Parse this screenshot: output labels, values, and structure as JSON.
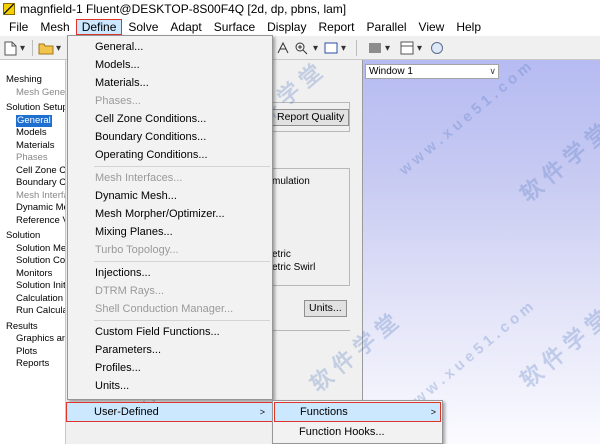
{
  "window": {
    "title": "magnfield-1 Fluent@DESKTOP-8S00F4Q  [2d, dp, pbns, lam]"
  },
  "menubar": {
    "items": [
      "File",
      "Mesh",
      "Define",
      "Solve",
      "Adapt",
      "Surface",
      "Display",
      "Report",
      "Parallel",
      "View",
      "Help"
    ],
    "active": "Define"
  },
  "colors": {
    "highlight": "#cce8ff",
    "highlight_border": "#e0342a",
    "tree_selection": "#1e6fd0"
  },
  "tree": {
    "groups": [
      {
        "label": "Meshing",
        "children": [
          {
            "label": "Mesh Generation",
            "state": "dim"
          }
        ]
      },
      {
        "label": "Solution Setup",
        "children": [
          {
            "label": "General",
            "state": "selected"
          },
          {
            "label": "Models",
            "state": "normal"
          },
          {
            "label": "Materials",
            "state": "normal"
          },
          {
            "label": "Phases",
            "state": "dim"
          },
          {
            "label": "Cell Zone Conditions",
            "state": "normal"
          },
          {
            "label": "Boundary Conditions",
            "state": "normal"
          },
          {
            "label": "Mesh Interfaces",
            "state": "dim"
          },
          {
            "label": "Dynamic Mesh",
            "state": "normal"
          },
          {
            "label": "Reference Values",
            "state": "normal"
          }
        ]
      },
      {
        "label": "Solution",
        "children": [
          {
            "label": "Solution Methods",
            "state": "normal"
          },
          {
            "label": "Solution Controls",
            "state": "normal"
          },
          {
            "label": "Monitors",
            "state": "normal"
          },
          {
            "label": "Solution Initialization",
            "state": "normal"
          },
          {
            "label": "Calculation Activities",
            "state": "normal"
          },
          {
            "label": "Run Calculation",
            "state": "normal"
          }
        ]
      },
      {
        "label": "Results",
        "children": [
          {
            "label": "Graphics and Animations",
            "state": "normal"
          },
          {
            "label": "Plots",
            "state": "normal"
          },
          {
            "label": "Reports",
            "state": "normal"
          }
        ]
      }
    ]
  },
  "general_panel": {
    "report_quality_label": "Report Quality",
    "simulation_label": "mulation",
    "option_axisymmetric": "etric",
    "option_axisymmetric_swirl": "etric Swirl",
    "units_label": "Units..."
  },
  "graphics": {
    "window_selector": "Window 1"
  },
  "define_menu": {
    "items": [
      {
        "label": "General...",
        "enabled": true
      },
      {
        "label": "Models...",
        "enabled": true
      },
      {
        "label": "Materials...",
        "enabled": true
      },
      {
        "label": "Phases...",
        "enabled": false
      },
      {
        "label": "Cell Zone Conditions...",
        "enabled": true
      },
      {
        "label": "Boundary Conditions...",
        "enabled": true
      },
      {
        "label": "Operating Conditions...",
        "enabled": true
      },
      {
        "separator": true
      },
      {
        "label": "Mesh Interfaces...",
        "enabled": false
      },
      {
        "label": "Dynamic Mesh...",
        "enabled": true
      },
      {
        "label": "Mesh Morpher/Optimizer...",
        "enabled": true
      },
      {
        "label": "Mixing Planes...",
        "enabled": true
      },
      {
        "label": "Turbo Topology...",
        "enabled": false
      },
      {
        "separator": true
      },
      {
        "label": "Injections...",
        "enabled": true
      },
      {
        "label": "DTRM Rays...",
        "enabled": false
      },
      {
        "label": "Shell Conduction Manager...",
        "enabled": false
      },
      {
        "separator": true
      },
      {
        "label": "Custom Field Functions...",
        "enabled": true
      },
      {
        "label": "Parameters...",
        "enabled": true
      },
      {
        "label": "Profiles...",
        "enabled": true
      },
      {
        "label": "Units...",
        "enabled": true
      }
    ],
    "user_defined": "User-Defined"
  },
  "user_defined_submenu": {
    "items": [
      {
        "label": "Functions",
        "has_submenu": true
      },
      {
        "label": "Function Hooks...",
        "has_submenu": false
      }
    ]
  },
  "watermark": [
    "软 件 学 堂",
    "w w w . x u e 5 1 . c o m"
  ]
}
